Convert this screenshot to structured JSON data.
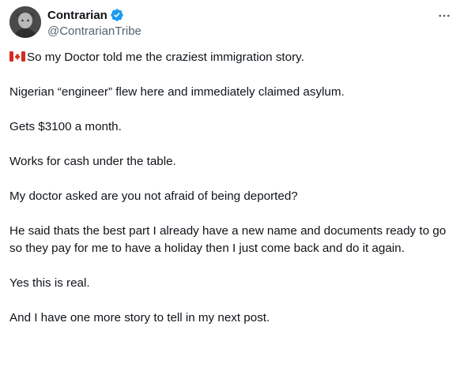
{
  "author": {
    "display_name": "Contrarian",
    "handle": "@ContrarianTribe",
    "verified": true,
    "verified_color": "#1d9bf0"
  },
  "menu_icon": "more-horizontal-icon",
  "flag_icon": "canada-flag-icon",
  "tweet": {
    "lines": [
      "So my Doctor told me the craziest immigration story.",
      "Nigerian “engineer” flew here and immediately claimed asylum.",
      "Gets $3100 a month.",
      "Works for cash under the table.",
      "My doctor asked are you not afraid of being deported?",
      "He said thats the best part I already have a new name and documents ready to go so they pay for me to have a holiday then I just come back and do it again.",
      "Yes this is real.",
      "And I have one more story to tell in my next post."
    ]
  },
  "colors": {
    "text": "#0f1419",
    "secondary": "#536471",
    "flag_red": "#d52b1e"
  }
}
